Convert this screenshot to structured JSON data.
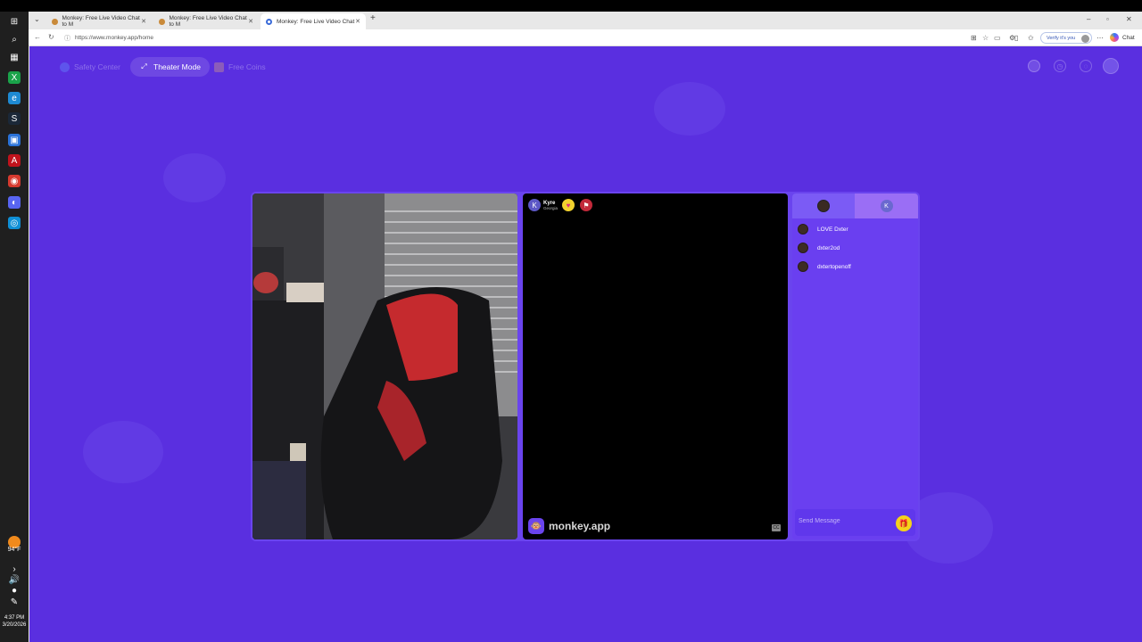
{
  "browser": {
    "tabs": [
      {
        "label": "Monkey: Free Live Video Chat to M"
      },
      {
        "label": "Monkey: Free Live Video Chat to M"
      },
      {
        "label": "Monkey: Free Live Video Chat"
      }
    ],
    "url": "https://www.monkey.app/home",
    "verify_label": "Verify it's you",
    "chat_label": "Chat"
  },
  "taskbar": {
    "temperature": "94°F",
    "time": "4:37 PM",
    "date": "3/20/2026"
  },
  "header": {
    "safety_center": "Safety Center",
    "theater_mode": "Theater Mode",
    "free_coins": "Free Coins"
  },
  "peer": {
    "initial": "K",
    "name": "Kyre",
    "location": "Georgia"
  },
  "brand": {
    "name": "monkey.app"
  },
  "chat": {
    "tab_b_initial": "K",
    "messages": [
      {
        "text": "LOVE Dxter"
      },
      {
        "text": "dxter2od"
      },
      {
        "text": "dxtertopenoff"
      }
    ],
    "placeholder": "Send Message"
  }
}
